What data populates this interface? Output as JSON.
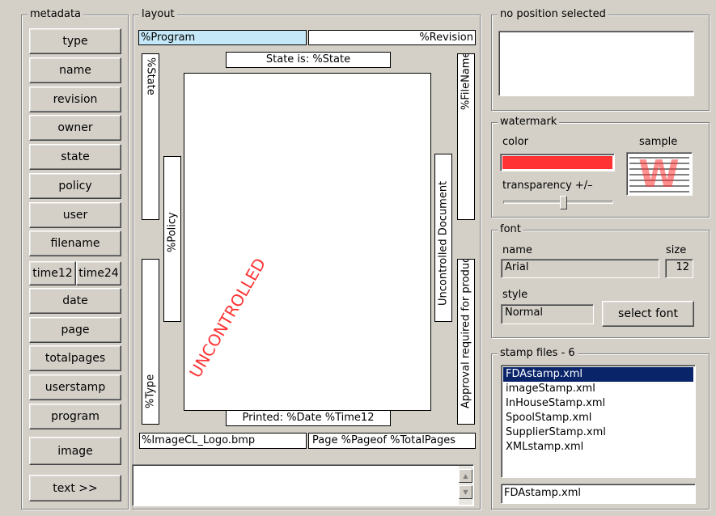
{
  "metadata": {
    "legend": "metadata",
    "buttons": [
      "type",
      "name",
      "revision",
      "owner",
      "state",
      "policy",
      "user",
      "filename"
    ],
    "time12": "time12",
    "time24": "time24",
    "buttons2": [
      "date",
      "page",
      "totalpages",
      "userstamp",
      "program"
    ],
    "image": "image",
    "text": "text >>"
  },
  "layout": {
    "legend": "layout",
    "program": "%Program",
    "revision": "%Revision",
    "state_is": "State is: %State",
    "state_v": "%State",
    "filename_v": "%FileName",
    "policy_v": "%Policy",
    "type_v": "%Type",
    "uncontrolled_doc": "Uncontrolled Document",
    "approval": "Approval required for production",
    "watermark": "UNCONTROLLED",
    "printed": "Printed: %Date %Time12",
    "image_logo": "%ImageCL_Logo.bmp",
    "page_of": "Page %Pageof %TotalPages",
    "text_value": ""
  },
  "position": {
    "legend": "no position selected"
  },
  "watermark": {
    "legend": "watermark",
    "color_label": "color",
    "sample_label": "sample",
    "sample_letter": "W",
    "transparency_label": "transparency +/–",
    "color": "#ff3333",
    "transparency_level": 0.55
  },
  "font": {
    "legend": "font",
    "name_label": "name",
    "size_label": "size",
    "name_value": "Arial",
    "size_value": "12",
    "style_label": "style",
    "style_value": "Normal",
    "select_button": "select font"
  },
  "stamp_files": {
    "legend": "stamp files - 6",
    "items": [
      "FDAstamp.xml",
      "imageStamp.xml",
      "InHouseStamp.xml",
      "SpoolStamp.xml",
      "SupplierStamp.xml",
      "XMLstamp.xml"
    ],
    "selected_index": 0,
    "current": "FDAstamp.xml"
  }
}
